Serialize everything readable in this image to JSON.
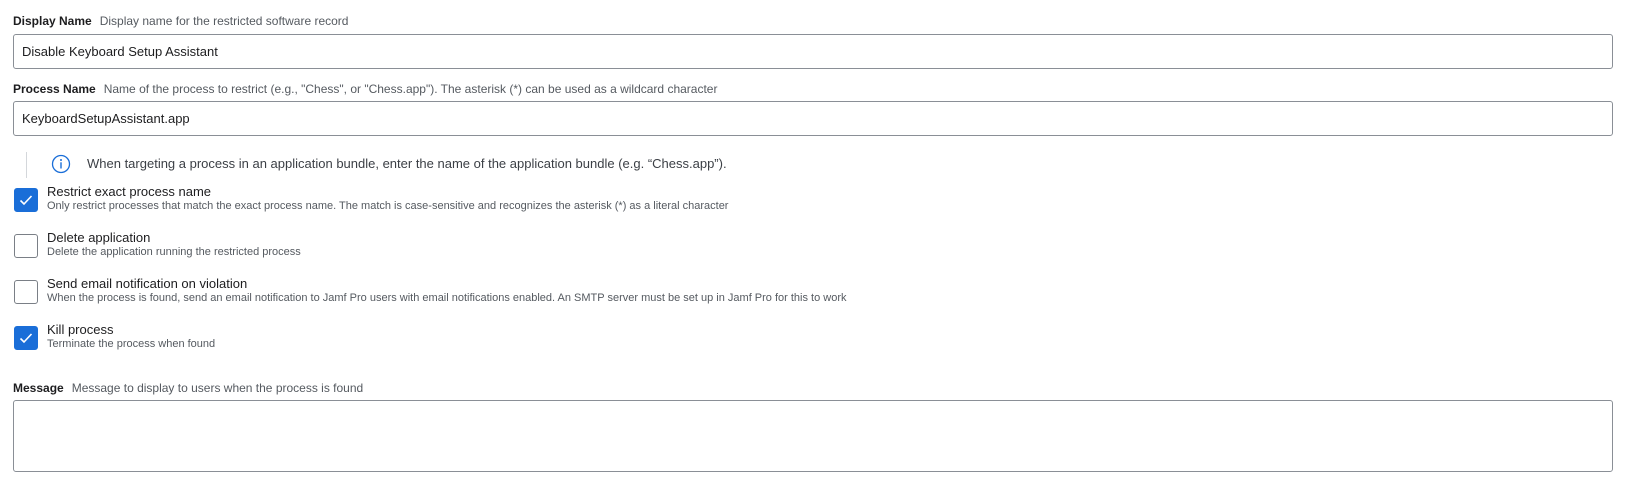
{
  "display_name": {
    "label": "Display Name",
    "description": "Display name for the restricted software record",
    "value": "Disable Keyboard Setup Assistant"
  },
  "process_name": {
    "label": "Process Name",
    "description": "Name of the process to restrict (e.g., \"Chess\", or \"Chess.app\"). The asterisk (*) can be used as a wildcard character",
    "value": "KeyboardSetupAssistant.app"
  },
  "info_note": {
    "icon": "info-icon",
    "text": "When targeting a process in an application bundle, enter the name of the application bundle (e.g. “Chess.app”)."
  },
  "options": [
    {
      "title": "Restrict exact process name",
      "description": "Only restrict processes that match the exact process name. The match is case-sensitive and recognizes the asterisk (*) as a literal character",
      "checked": true
    },
    {
      "title": "Delete application",
      "description": "Delete the application running the restricted process",
      "checked": false
    },
    {
      "title": "Send email notification on violation",
      "description": "When the process is found, send an email notification to Jamf Pro users with email notifications enabled. An SMTP server must be set up in Jamf Pro for this to work",
      "checked": false
    },
    {
      "title": "Kill process",
      "description": "Terminate the process when found",
      "checked": true
    }
  ],
  "message": {
    "label": "Message",
    "description": "Message to display to users when the process is found",
    "value": ""
  },
  "colors": {
    "accent": "#1a6ed8",
    "border": "#8a8f96",
    "muted_text": "#555a60"
  }
}
